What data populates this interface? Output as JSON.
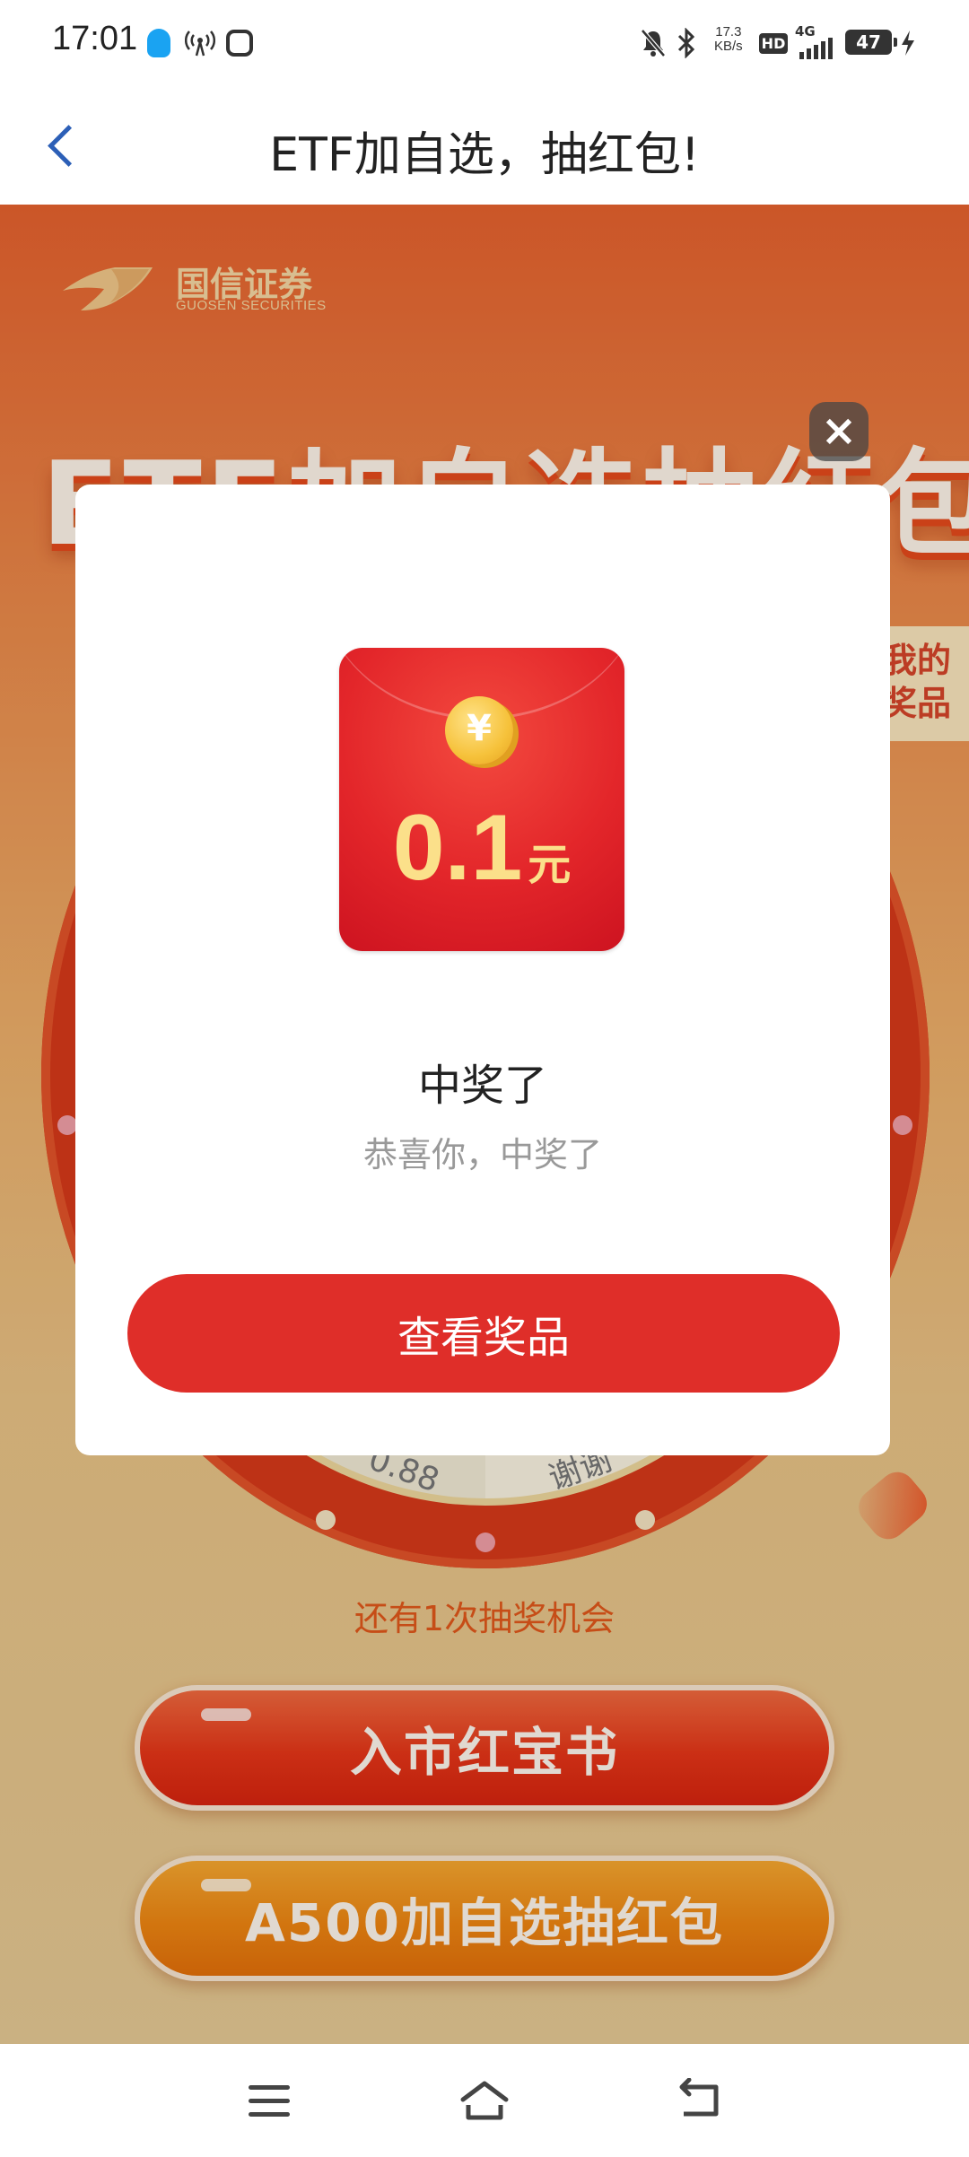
{
  "status_bar": {
    "time": "17:01",
    "net_speed_value": "17.3",
    "net_speed_unit": "KB/s",
    "hd_label": "HD",
    "network_type": "4G",
    "battery_level": "47",
    "icons": [
      "qq-icon",
      "hotspot-icon",
      "app-icon",
      "mute-icon",
      "bluetooth-icon",
      "signal-icon",
      "battery-icon",
      "charging-icon"
    ]
  },
  "nav": {
    "title": "ETF加自选，抽红包!",
    "accent_color": "#2c5fb7"
  },
  "campaign": {
    "logo_name": "国信证券",
    "logo_sub": "GUOSEN SECURITIES",
    "hero_title": "ETF加自选抽红包",
    "my_prize_tab": "我的奖品",
    "wheel_label_left": "0.88",
    "wheel_label_right": "谢谢",
    "remaining_chances": "还有1次抽奖机会",
    "buttons": {
      "red_book": "入市红宝书",
      "a500": "A500加自选抽红包"
    }
  },
  "modal": {
    "close_symbol": "×",
    "coin_symbol": "¥",
    "amount_value": "0.1",
    "amount_unit": "元",
    "title": "中奖了",
    "subtitle": "恭喜你，中奖了",
    "action_button": "查看奖品",
    "button_color": "#df2e29"
  },
  "system_nav": {
    "icons": [
      "menu-icon",
      "home-icon",
      "back-icon"
    ]
  }
}
